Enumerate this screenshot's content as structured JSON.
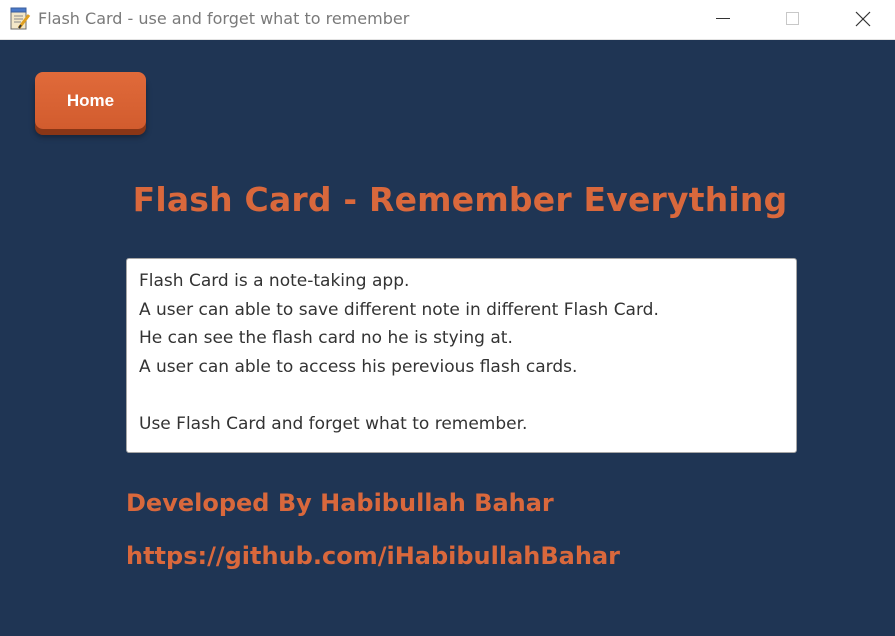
{
  "window": {
    "title": "Flash Card - use and forget what to remember",
    "app_icon": "notepad-icon",
    "controls": [
      "minimize-icon",
      "maximize-icon",
      "close-icon"
    ]
  },
  "home_button": {
    "label": "Home"
  },
  "heading": "Flash Card - Remember Everything",
  "notes": {
    "lines": [
      "Flash Card is a note-taking app.",
      "A user can able to save different note in different Flash Card.",
      "He can see the flash card no he is stying at.",
      "A user can able to access his perevious flash cards.",
      "",
      "Use Flash Card and forget what to remember."
    ]
  },
  "developer": "Developed By Habibullah Bahar",
  "github_link": "https://github.com/iHabibullahBahar",
  "colors": {
    "background": "#1f3554",
    "accent": "#d9683c",
    "button": "#d25c2e",
    "titlebar": "#ffffff"
  }
}
